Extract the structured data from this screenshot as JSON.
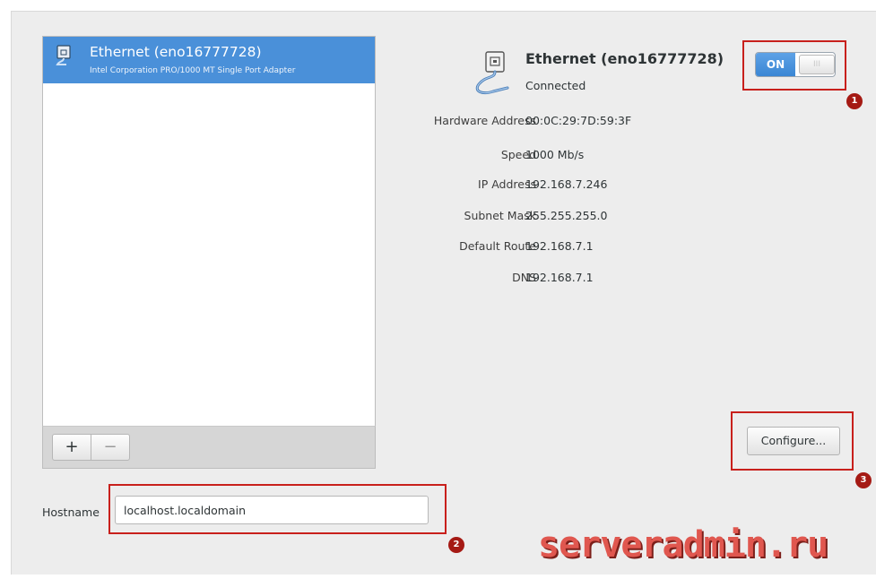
{
  "devices": [
    {
      "name": "Ethernet (eno16777728)",
      "description": "Intel Corporation PRO/1000 MT Single Port Adapter"
    }
  ],
  "list_toolbar": {
    "add_label": "+",
    "remove_label": "−"
  },
  "detail": {
    "title": "Ethernet (eno16777728)",
    "status": "Connected",
    "toggle_label": "ON",
    "toggle_off_label": "III"
  },
  "properties": [
    {
      "label": "Hardware Address",
      "value": "00:0C:29:7D:59:3F"
    },
    {
      "label": "Speed",
      "value": "1000 Mb/s"
    },
    {
      "label": "IP Address",
      "value": "192.168.7.246"
    },
    {
      "label": "Subnet Mask",
      "value": "255.255.255.0"
    },
    {
      "label": "Default Route",
      "value": "192.168.7.1"
    },
    {
      "label": "DNS",
      "value": "192.168.7.1"
    }
  ],
  "configure_label": "Configure...",
  "hostname": {
    "label": "Hostname",
    "value": "localhost.localdomain"
  },
  "annotations": [
    "1",
    "2",
    "3"
  ],
  "watermark": "serveradmin.ru",
  "colors": {
    "selection": "#4a90d9",
    "annotation": "#c8201c",
    "toggle_on": "#4a90d9"
  },
  "icons": {
    "device_icon": "ethernet-icon",
    "add": "plus-icon",
    "remove": "minus-icon"
  }
}
